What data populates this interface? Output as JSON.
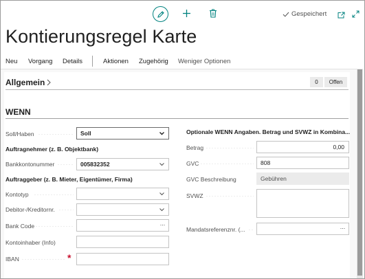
{
  "header": {
    "saved_label": "Gespeichert",
    "title": "Kontierungsregel Karte"
  },
  "icons": {
    "edit": "pencil-icon",
    "new": "plus-icon",
    "delete": "trash-icon",
    "saved": "checkmark-icon",
    "open_new": "open-in-new-window-icon",
    "expand": "expand-icon"
  },
  "menu": {
    "items": [
      "Neu",
      "Vorgang",
      "Details",
      "Aktionen",
      "Zugehörig",
      "Weniger Optionen"
    ]
  },
  "section": {
    "title": "Allgemein",
    "badge_count": "0",
    "badge_open": "Offen"
  },
  "group": {
    "title": "WENN"
  },
  "left": {
    "soll_haben": {
      "label": "Soll/Haben",
      "value": "Soll"
    },
    "auftragnehmer_heading": "Auftragnehmer (z. B. Objektbank)",
    "bankkonto": {
      "label": "Bankkontonummer",
      "value": "005832352"
    },
    "auftraggeber_heading": "Auftraggeber (z. B. Mieter, Eigentümer, Firma)",
    "kontotyp": {
      "label": "Kontotyp",
      "value": ""
    },
    "debitor": {
      "label": "Debitor-/Kreditornr.",
      "value": ""
    },
    "bank_code": {
      "label": "Bank Code",
      "value": ""
    },
    "kontoinhaber": {
      "label": "Kontoinhaber (Info)",
      "value": ""
    },
    "iban": {
      "label": "IBAN",
      "value": ""
    }
  },
  "right": {
    "heading": "Optionale WENN Angaben. Betrag und SVWZ in Kombina...",
    "betrag": {
      "label": "Betrag",
      "value": "0,00"
    },
    "gvc": {
      "label": "GVC",
      "value": "808"
    },
    "gvc_beschreibung": {
      "label": "GVC Beschreibung",
      "value": "Gebühren"
    },
    "svwz": {
      "label": "SVWZ",
      "value": ""
    },
    "mandat": {
      "label": "Mandatsreferenznr. (...",
      "value": ""
    }
  },
  "colors": {
    "accent": "#00827f",
    "required": "#c8102e"
  }
}
